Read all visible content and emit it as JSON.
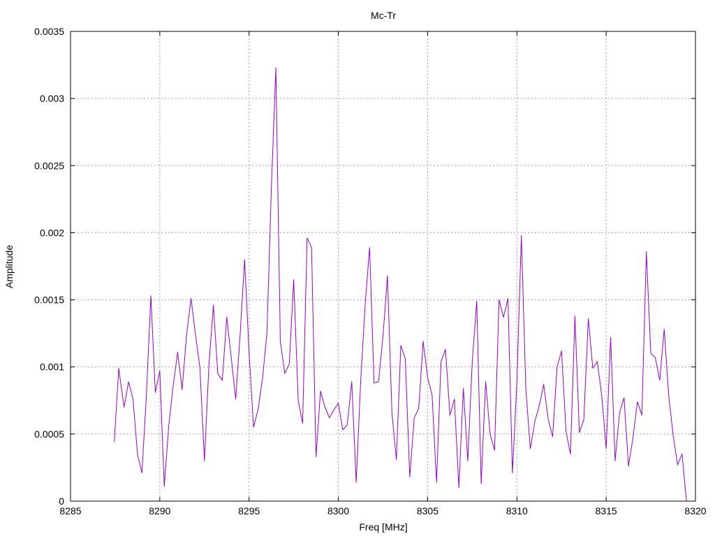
{
  "chart_data": {
    "type": "line",
    "title": "Mc-Tr",
    "xlabel": "Freq [MHz]",
    "ylabel": "Amplitude",
    "xlim": [
      8285,
      8320
    ],
    "ylim": [
      0,
      0.0035
    ],
    "x_ticks": [
      8285,
      8290,
      8295,
      8300,
      8305,
      8310,
      8315,
      8320
    ],
    "y_ticks": [
      0,
      0.0005,
      0.001,
      0.0015,
      0.002,
      0.0025,
      0.003,
      0.0035
    ],
    "x_tick_labels": [
      "8285",
      "8290",
      "8295",
      "8300",
      "8305",
      "8310",
      "8315",
      "8320"
    ],
    "y_tick_labels": [
      "0",
      "0.0005",
      "0.001",
      "0.0015",
      "0.002",
      "0.0025",
      "0.003",
      "0.0035"
    ],
    "grid": true,
    "line_color": "#9400d3",
    "series": [
      {
        "x": [
          8287.45,
          8287.7,
          8288.0,
          8288.25,
          8288.5,
          8288.75,
          8289.0,
          8289.25,
          8289.5,
          8289.75,
          8290.0,
          8290.25,
          8290.5,
          8290.75,
          8291.0,
          8291.25,
          8291.5,
          8291.75,
          8292.0,
          8292.25,
          8292.5,
          8292.75,
          8293.0,
          8293.25,
          8293.5,
          8293.75,
          8294.0,
          8294.25,
          8294.5,
          8294.75,
          8295.0,
          8295.25,
          8295.5,
          8295.75,
          8296.0,
          8296.25,
          8296.5,
          8296.75,
          8297.0,
          8297.25,
          8297.5,
          8297.75,
          8298.0,
          8298.25,
          8298.5,
          8298.75,
          8299.0,
          8299.25,
          8299.5,
          8299.75,
          8300.0,
          8300.25,
          8300.5,
          8300.75,
          8301.0,
          8301.25,
          8301.5,
          8301.75,
          8302.0,
          8302.25,
          8302.5,
          8302.75,
          8303.0,
          8303.25,
          8303.5,
          8303.75,
          8304.0,
          8304.25,
          8304.5,
          8304.75,
          8305.0,
          8305.25,
          8305.5,
          8305.75,
          8306.0,
          8306.25,
          8306.5,
          8306.75,
          8307.0,
          8307.25,
          8307.5,
          8307.75,
          8308.0,
          8308.25,
          8308.5,
          8308.75,
          8309.0,
          8309.25,
          8309.5,
          8309.75,
          8310.0,
          8310.25,
          8310.5,
          8310.75,
          8311.0,
          8311.25,
          8311.5,
          8311.75,
          8312.0,
          8312.25,
          8312.5,
          8312.75,
          8313.0,
          8313.25,
          8313.5,
          8313.75,
          8314.0,
          8314.25,
          8314.5,
          8314.75,
          8315.0,
          8315.25,
          8315.5,
          8315.75,
          8316.0,
          8316.25,
          8316.5,
          8316.75,
          8317.0,
          8317.25,
          8317.5,
          8317.75,
          8318.0,
          8318.25,
          8318.5,
          8318.75,
          8319.0,
          8319.25,
          8319.5
        ],
        "y": [
          0.00044,
          0.00099,
          0.0007,
          0.00089,
          0.00076,
          0.00035,
          0.00021,
          0.00079,
          0.00153,
          0.00081,
          0.00097,
          0.00011,
          0.00056,
          0.00086,
          0.00111,
          0.00083,
          0.00124,
          0.00151,
          0.00124,
          0.00099,
          0.0003,
          0.00101,
          0.00146,
          0.00095,
          0.0009,
          0.00137,
          0.00107,
          0.00076,
          0.00124,
          0.0018,
          0.00111,
          0.00055,
          0.00068,
          0.00091,
          0.00125,
          0.00234,
          0.00323,
          0.00119,
          0.00095,
          0.00102,
          0.00165,
          0.00075,
          0.00058,
          0.00196,
          0.00189,
          0.00033,
          0.00082,
          0.0007,
          0.00062,
          0.00068,
          0.00073,
          0.00053,
          0.00057,
          0.00089,
          0.00014,
          0.00089,
          0.00146,
          0.00189,
          0.00088,
          0.00089,
          0.00123,
          0.00168,
          0.00066,
          0.00031,
          0.00116,
          0.00106,
          0.00018,
          0.00062,
          0.00069,
          0.00119,
          0.00092,
          0.00079,
          0.00014,
          0.00104,
          0.00113,
          0.00064,
          0.00076,
          0.0001,
          0.00084,
          0.0003,
          0.00104,
          0.00149,
          0.00013,
          0.00089,
          0.0005,
          0.00038,
          0.0015,
          0.00137,
          0.00151,
          0.00021,
          0.00089,
          0.00198,
          0.00084,
          0.00039,
          0.00059,
          0.00071,
          0.00087,
          0.00061,
          0.00048,
          0.001,
          0.00112,
          0.00052,
          0.00035,
          0.00138,
          0.00051,
          0.00061,
          0.00136,
          0.00099,
          0.00104,
          0.00079,
          0.00039,
          0.00122,
          0.0003,
          0.00066,
          0.00077,
          0.00026,
          0.00047,
          0.00074,
          0.00064,
          0.00186,
          0.0011,
          0.00107,
          0.0009,
          0.00128,
          0.00079,
          0.00049,
          0.00027,
          0.00035,
          0.0
        ]
      }
    ]
  }
}
